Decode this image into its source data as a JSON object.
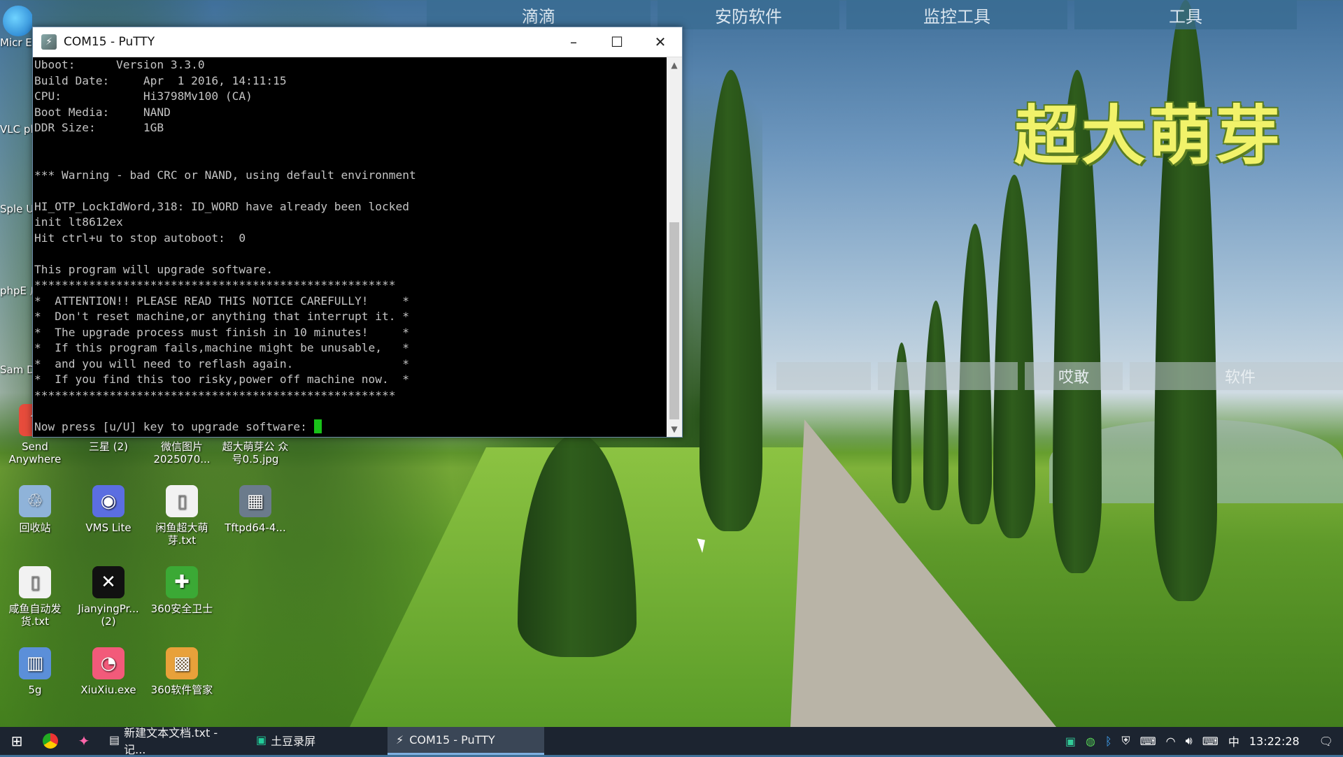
{
  "top_categories": [
    "滴滴",
    "安防软件",
    "监控工具",
    "工具"
  ],
  "mid_categories": [
    "",
    "",
    "哎敢",
    "软件"
  ],
  "watermark": "超大萌芽",
  "desktop_icons": [
    {
      "label": "Send Anywhere",
      "icon": "send-anywhere-icon",
      "color": "#e74c3c",
      "glyph": "⇪"
    },
    {
      "label": "三星 (2)",
      "icon": "folder-icon",
      "color": "#d9a441",
      "glyph": "▤"
    },
    {
      "label": "微信图片 2025070...",
      "icon": "image-file-icon",
      "color": "#c0392b",
      "glyph": "▣"
    },
    {
      "label": "超大萌芽公 众号0.5.jpg",
      "icon": "image-file-icon",
      "color": "#5d8aa8",
      "glyph": "▣"
    },
    {
      "label": "回收站",
      "icon": "recycle-bin-icon",
      "color": "#8fb3d9",
      "glyph": "♲"
    },
    {
      "label": "VMS Lite",
      "icon": "vms-lite-icon",
      "color": "#5b6ee1",
      "glyph": "◉"
    },
    {
      "label": "闲鱼超大萌 芽.txt",
      "icon": "text-file-icon",
      "color": "#f2f2f2",
      "glyph": "▯"
    },
    {
      "label": "Tftpd64-4...",
      "icon": "tftpd-icon",
      "color": "#6b7b8c",
      "glyph": "▦"
    },
    {
      "label": "咸鱼自动发 货.txt",
      "icon": "text-file-icon",
      "color": "#f2f2f2",
      "glyph": "▯"
    },
    {
      "label": "JianyingPr... (2)",
      "icon": "jianying-icon",
      "color": "#111111",
      "glyph": "✕"
    },
    {
      "label": "360安全卫士",
      "icon": "360-safe-icon",
      "color": "#3ba935",
      "glyph": "✚"
    },
    {
      "label": "5g",
      "icon": "5g-file-icon",
      "color": "#5b8fd9",
      "glyph": "▥"
    },
    {
      "label": "XiuXiu.exe",
      "icon": "xiuxiu-icon",
      "color": "#f25a7a",
      "glyph": "◔"
    },
    {
      "label": "360软件管家",
      "icon": "360-software-icon",
      "color": "#e8a13a",
      "glyph": "▩"
    }
  ],
  "left_partial_labels": [
    "Micr Ed",
    "VLC pla",
    "Sple Ut",
    "phpE 启动",
    "Sam D"
  ],
  "putty": {
    "title": "COM15 - PuTTY",
    "minimize": "–",
    "maximize": "☐",
    "close": "✕",
    "lines": [
      "Uboot:      Version 3.3.0",
      "Build Date:     Apr  1 2016, 14:11:15",
      "CPU:            Hi3798Mv100 (CA)",
      "Boot Media:     NAND",
      "DDR Size:       1GB",
      "",
      "",
      "*** Warning - bad CRC or NAND, using default environment",
      "",
      "HI_OTP_LockIdWord,318: ID_WORD have already been locked",
      "init lt8612ex",
      "Hit ctrl+u to stop autoboot:  0",
      "",
      "This program will upgrade software.",
      "*****************************************************",
      "*  ATTENTION!! PLEASE READ THIS NOTICE CAREFULLY!     *",
      "*  Don't reset machine,or anything that interrupt it. *",
      "*  The upgrade process must finish in 10 minutes!     *",
      "*  If this program fails,machine might be unusable,   *",
      "*  and you will need to reflash again.                *",
      "*  If you find this too risky,power off machine now.  *",
      "*****************************************************",
      "",
      "Now press [u/U] key to upgrade software: "
    ]
  },
  "taskbar": {
    "tasks": [
      {
        "label": "新建文本文档.txt - 记...",
        "active": false
      },
      {
        "label": "土豆录屏",
        "active": false
      },
      {
        "label": "COM15 - PuTTY",
        "active": true
      }
    ],
    "ime": "中",
    "time": "13:22:28"
  }
}
